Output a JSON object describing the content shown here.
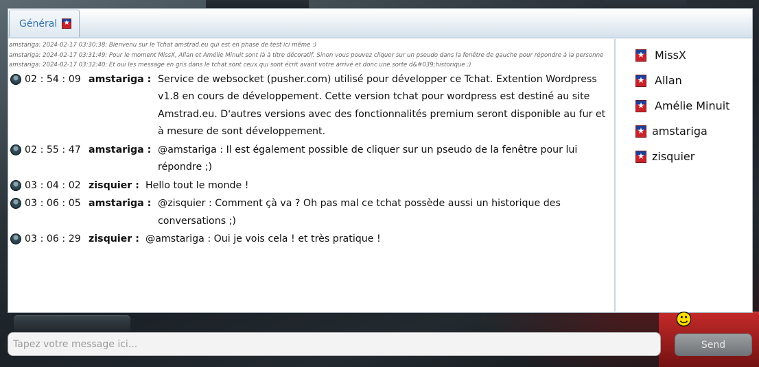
{
  "tabs": [
    {
      "label": "Général",
      "icon": "amstrad-flag-icon"
    }
  ],
  "system_lines": [
    "amstariga: 2024-02-17 03:30:38: Bienvenu sur le Tchat amstrad.eu qui est en phase de test ici même :)",
    "amstariga: 2024-02-17 03:31:49: Pour le moment MissX, Allan et Amélie Minuit sont là à titre décoratif. Sinon vous pouvez cliquer sur un pseudo dans la fenêtre de gauche pour répondre à la personne",
    "amstariga: 2024-02-17 03:32:40: Et oui les message en gris dans le tchat sont ceux qui sont écrit avant votre arrivé et donc une sorte d&#039;historique :)"
  ],
  "messages": [
    {
      "time": "02 : 54 : 09",
      "nick": "amstariga :",
      "text": "Service de websocket (pusher.com) utilisé pour développer ce Tchat. Extention Wordpress v1.8 en cours de développement. Cette version tchat pour wordpress est destiné au site Amstrad.eu. D'autres versions avec des fonctionnalités premium seront disponible au fur et à mesure de sont développement."
    },
    {
      "time": "02 : 55 : 47",
      "nick": "amstariga :",
      "text": "@amstariga : Il est également possible de cliquer sur un pseudo de la fenêtre pour lui répondre ;)"
    },
    {
      "time": "03 : 04 : 02",
      "nick": "zisquier :",
      "text": "Hello tout le monde !"
    },
    {
      "time": "03 : 06 : 05",
      "nick": "amstariga :",
      "text": "@zisquier : Comment çà va ? Oh pas mal ce tchat possède aussi un historique des conversations ;)"
    },
    {
      "time": "03 : 06 : 29",
      "nick": "zisquier :",
      "text": "@amstariga : Oui je vois cela ! et très pratique !"
    }
  ],
  "users": [
    "MissX",
    "Allan",
    "Amélie Minuit",
    "amstariga",
    "zisquier"
  ],
  "composer": {
    "placeholder": "Tapez votre message ici...",
    "value": "",
    "send_label": "Send"
  },
  "colors": {
    "tab_text": "#3673ad",
    "flag_red": "#c8222b",
    "flag_blue": "#1d3f9a"
  }
}
